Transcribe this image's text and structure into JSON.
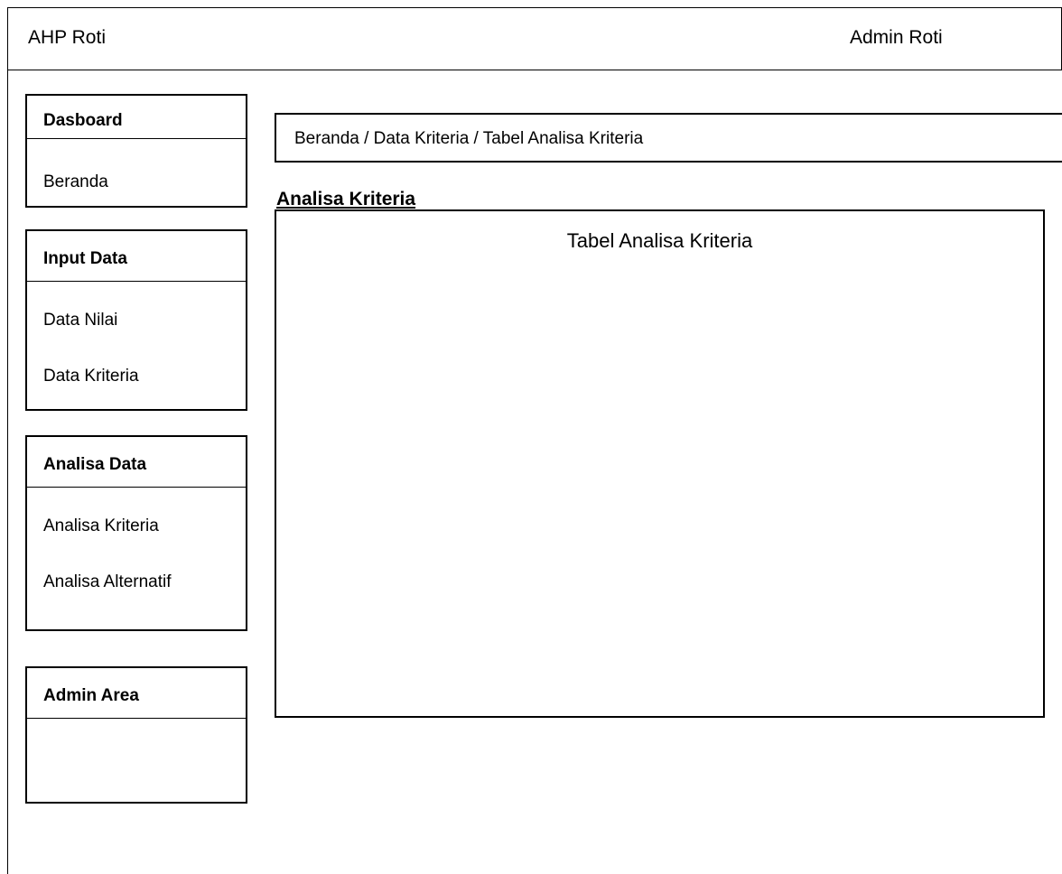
{
  "header": {
    "app_title": "AHP Roti",
    "user_name": "Admin Roti"
  },
  "sidebar": {
    "groups": [
      {
        "title": "Dasboard",
        "items": [
          "Beranda"
        ]
      },
      {
        "title": "Input Data",
        "items": [
          "Data Nilai",
          "Data Kriteria"
        ]
      },
      {
        "title": "Analisa Data",
        "items": [
          "Analisa Kriteria",
          "Analisa Alternatif"
        ]
      },
      {
        "title": "Admin Area",
        "items": []
      }
    ]
  },
  "main": {
    "breadcrumb": "Beranda / Data Kriteria / Tabel Analisa Kriteria",
    "section_title": "Analisa Kriteria",
    "table_caption": "Tabel Analisa Kriteria"
  }
}
